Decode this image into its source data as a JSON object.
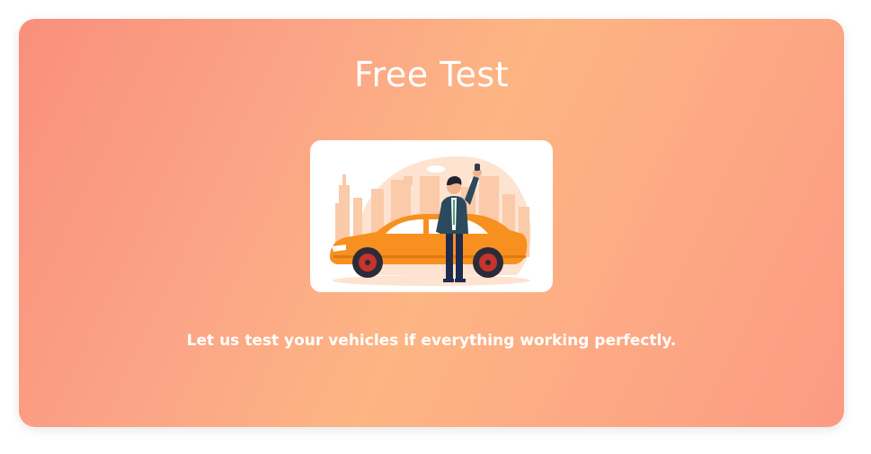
{
  "card": {
    "title": "Free Test",
    "illustration_icon": "car-owner-with-keys-icon",
    "caption": "Let us test your vehicles if everything working perfectly."
  },
  "colors": {
    "gradient_start": "#f98f7c",
    "gradient_mid": "#fdb583",
    "gradient_end": "#fb9b82",
    "car_body": "#f7901e",
    "text": "#ffffff"
  }
}
